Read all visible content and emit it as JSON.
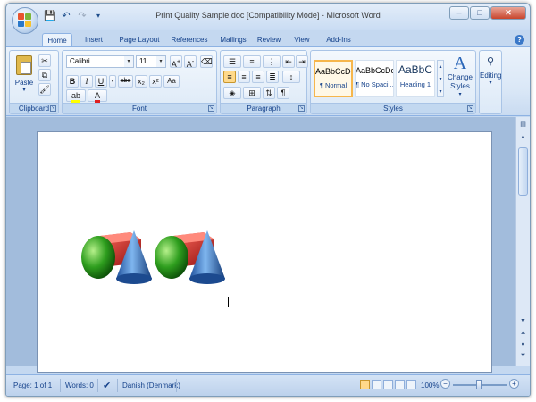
{
  "window": {
    "title": "Print Quality Sample.doc [Compatibility Mode] - Microsoft Word"
  },
  "quick_access": {
    "icons": [
      "save-icon",
      "undo-icon",
      "redo-icon",
      "customize-icon"
    ]
  },
  "window_controls": {
    "minimize": "–",
    "maximize": "□",
    "close": "✕"
  },
  "tabs": [
    "Home",
    "Insert",
    "Page Layout",
    "References",
    "Mailings",
    "Review",
    "View",
    "Add-Ins"
  ],
  "active_tab": "Home",
  "ribbon": {
    "clipboard": {
      "label": "Clipboard",
      "paste_label": "Paste"
    },
    "font": {
      "label": "Font",
      "font_name": "Calibri",
      "font_size": "11",
      "buttons": [
        "B",
        "I",
        "U",
        "abe",
        "x₂",
        "x²",
        "Aa"
      ]
    },
    "paragraph": {
      "label": "Paragraph"
    },
    "styles": {
      "label": "Styles",
      "items": [
        {
          "sample": "AaBbCcDc",
          "name": "¶ Normal"
        },
        {
          "sample": "AaBbCcDc",
          "name": "¶ No Spaci..."
        },
        {
          "sample": "AaBbC",
          "name": "Heading 1"
        }
      ],
      "change_label": "Change Styles"
    },
    "editing": {
      "label": "Editing"
    }
  },
  "status_bar": {
    "page": "Page: 1 of 1",
    "words": "Words: 0",
    "language": "Danish (Denmark)",
    "zoom": "100%"
  },
  "colors": {
    "ribbon_bg": "#dbe8f7",
    "doc_bg": "#a2bcdc",
    "accent": "#15428b"
  }
}
